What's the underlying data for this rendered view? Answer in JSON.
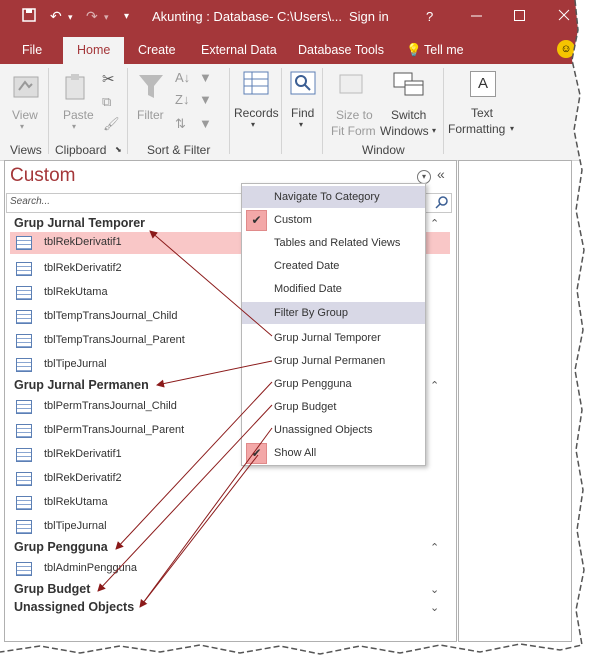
{
  "window": {
    "title": "Akunting : Database- C:\\Users\\...",
    "signin": "Sign in",
    "help": "?",
    "ribbon_display_icon": "ribbon-display-icon"
  },
  "tabs": [
    "File",
    "Home",
    "Create",
    "External Data",
    "Database Tools"
  ],
  "tell_me": "Tell me",
  "ribbon": {
    "groups": {
      "views": "Views",
      "clipboard": "Clipboard",
      "sort_filter": "Sort & Filter",
      "window": "Window"
    },
    "buttons": {
      "view": "View",
      "paste": "Paste",
      "filter": "Filter",
      "records": "Records",
      "find": "Find",
      "size_to_fit_1": "Size to",
      "size_to_fit_2": "Fit Form",
      "switch_windows_1": "Switch",
      "switch_windows_2": "Windows",
      "text_formatting_1": "Text",
      "text_formatting_2": "Formatting",
      "text_icon": "A"
    }
  },
  "nav": {
    "title": "Custom",
    "search_placeholder": "Search...",
    "groups": [
      {
        "name": "Grup Jurnal Temporer",
        "items": [
          "tblRekDerivatif1",
          "tblRekDerivatif2",
          "tblRekUtama",
          "tblTempTransJournal_Child",
          "tblTempTransJournal_Parent",
          "tblTipeJurnal"
        ]
      },
      {
        "name": "Grup Jurnal Permanen",
        "items": [
          "tblPermTransJournal_Child",
          "tblPermTransJournal_Parent",
          "tblRekDerivatif1",
          "tblRekDerivatif2",
          "tblRekUtama",
          "tblTipeJurnal"
        ]
      },
      {
        "name": "Grup Pengguna",
        "items": [
          "tblAdminPengguna"
        ]
      },
      {
        "name": "Grup Budget",
        "items": []
      },
      {
        "name": "Unassigned Objects",
        "items": []
      }
    ]
  },
  "menu": {
    "header1": "Navigate To Category",
    "categories": [
      "Custom",
      "Tables and Related Views",
      "Created Date",
      "Modified Date"
    ],
    "header2": "Filter By Group",
    "groups": [
      "Grup Jurnal Temporer",
      "Grup Jurnal Permanen",
      "Grup Pengguna",
      "Grup Budget",
      "Unassigned Objects",
      "Show All"
    ],
    "checked": [
      "Custom",
      "Show All"
    ]
  },
  "colors": {
    "brand": "#a4373a",
    "selected_row": "#f9c7c7",
    "check_bg": "#f3a8a8",
    "arrow": "#8b1a1a"
  }
}
